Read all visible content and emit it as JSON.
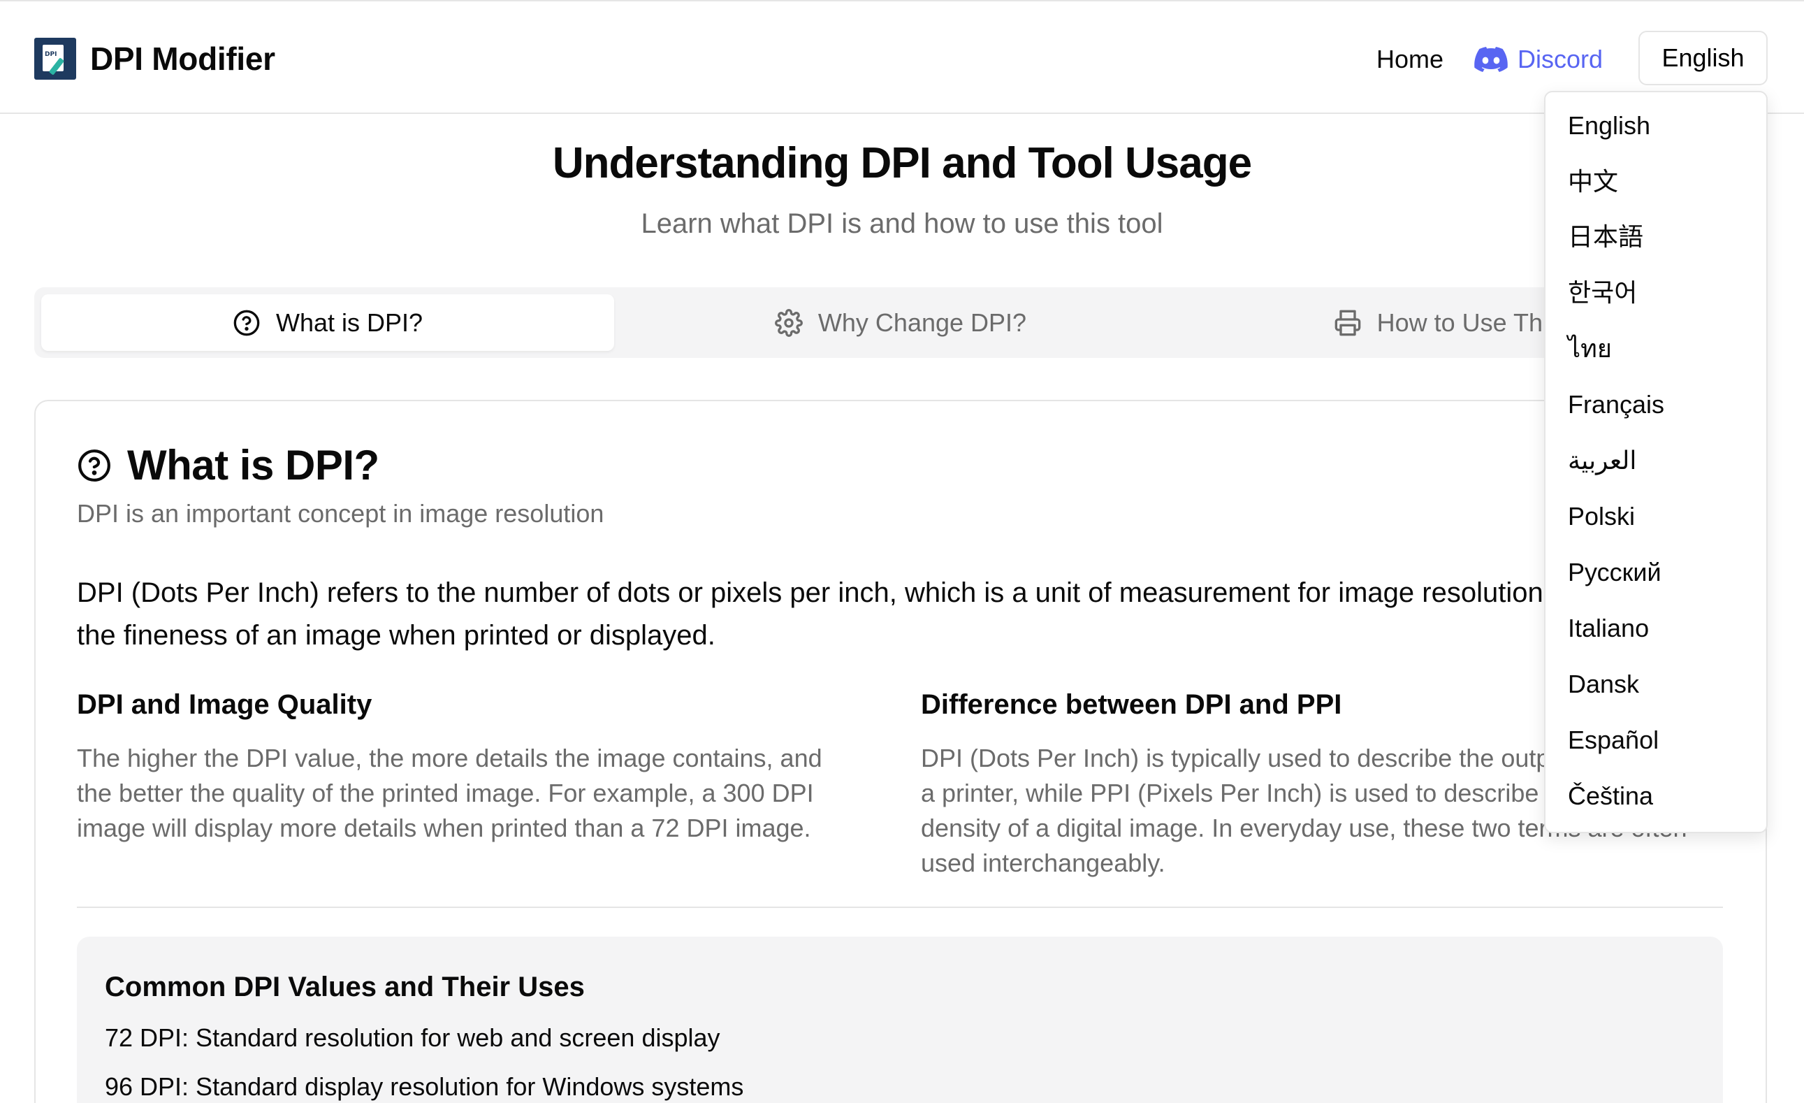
{
  "header": {
    "brand": "DPI Modifier",
    "logo_text": "DPI",
    "nav_home": "Home",
    "nav_discord": "Discord",
    "language_button": "English"
  },
  "hero": {
    "title": "Understanding DPI and Tool Usage",
    "subtitle": "Learn what DPI is and how to use this tool"
  },
  "tabs": [
    {
      "label": "What is DPI?",
      "icon": "question-circle-icon",
      "active": true
    },
    {
      "label": "Why Change DPI?",
      "icon": "gear-icon",
      "active": false
    },
    {
      "label": "How to Use This Tool",
      "icon": "printer-icon",
      "active": false
    }
  ],
  "section": {
    "title": "What is DPI?",
    "description": "DPI is an important concept in image resolution",
    "body": "DPI (Dots Per Inch) refers to the number of dots or pixels per inch, which is a unit of measurement for image resolution. It represents the fineness of an image when printed or displayed.",
    "col_left": {
      "heading": "DPI and Image Quality",
      "text": "The higher the DPI value, the more details the image contains, and the better the quality of the printed image. For example, a 300 DPI image will display more details when printed than a 72 DPI image."
    },
    "col_right": {
      "heading": "Difference between DPI and PPI",
      "text": "DPI (Dots Per Inch) is typically used to describe the output resolution of a printer, while PPI (Pixels Per Inch) is used to describe the pixel density of a digital image. In everyday use, these two terms are often used interchangeably."
    },
    "common": {
      "heading": "Common DPI Values and Their Uses",
      "items": [
        "72 DPI: Standard resolution for web and screen display",
        "96 DPI: Standard display resolution for Windows systems"
      ]
    }
  },
  "language_dropdown": {
    "options": [
      "English",
      "中文",
      "日本語",
      "한국어",
      "ไทย",
      "Français",
      "العربية",
      "Polski",
      "Русский",
      "Italiano",
      "Dansk",
      "Español",
      "Čeština"
    ]
  },
  "colors": {
    "discord": "#5865f2",
    "muted_text": "#6b6b6b",
    "border": "#e5e5e5",
    "tab_bg": "#f4f4f5"
  }
}
